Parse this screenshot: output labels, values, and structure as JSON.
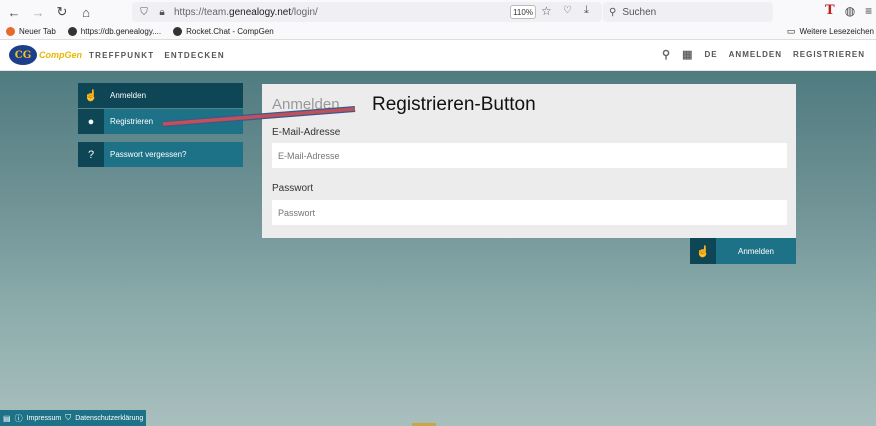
{
  "browser": {
    "url_prefix": "https://team.",
    "url_domain": "genealogy.net",
    "url_path": "/login/",
    "zoom": "110%",
    "search_placeholder": "Suchen",
    "icons": [
      "back-icon",
      "forward-icon",
      "reload-icon",
      "home-icon",
      "shield-icon",
      "lock-icon",
      "star-icon",
      "pocket-icon",
      "download-icon",
      "search-icon",
      "menu-icon"
    ]
  },
  "bookmarks": {
    "items": [
      {
        "label": "Neuer Tab"
      },
      {
        "label": "https://db.genealogy...."
      },
      {
        "label": "Rocket.Chat - CompGen"
      }
    ],
    "other": "Weitere Lesezeichen"
  },
  "site": {
    "logo_letters": "CG",
    "logo_text": "CompGen",
    "nav": [
      "TREFFPUNKT",
      "ENTDECKEN"
    ],
    "lang": "DE",
    "login": "ANMELDEN",
    "register": "REGISTRIEREN"
  },
  "sidebar": {
    "items": [
      {
        "label": "Anmelden"
      },
      {
        "label": "Registrieren"
      },
      {
        "label": "Passwort vergessen?"
      }
    ]
  },
  "form": {
    "heading": "Anmelden",
    "email_label": "E-Mail-Adresse",
    "email_placeholder": "E-Mail-Adresse",
    "password_label": "Passwort",
    "password_placeholder": "Passwort",
    "submit": "Anmelden"
  },
  "annotation": {
    "text": "Registrieren-Button",
    "arrow_color": "#c0505a"
  },
  "footer": {
    "impressum": "Impressum",
    "privacy": "Datenschutzerklärung"
  },
  "colors": {
    "teal": "#1d7287",
    "dark_teal": "#0f4656",
    "brand_blue": "#1c3f8c",
    "brand_gold": "#e6b800"
  }
}
